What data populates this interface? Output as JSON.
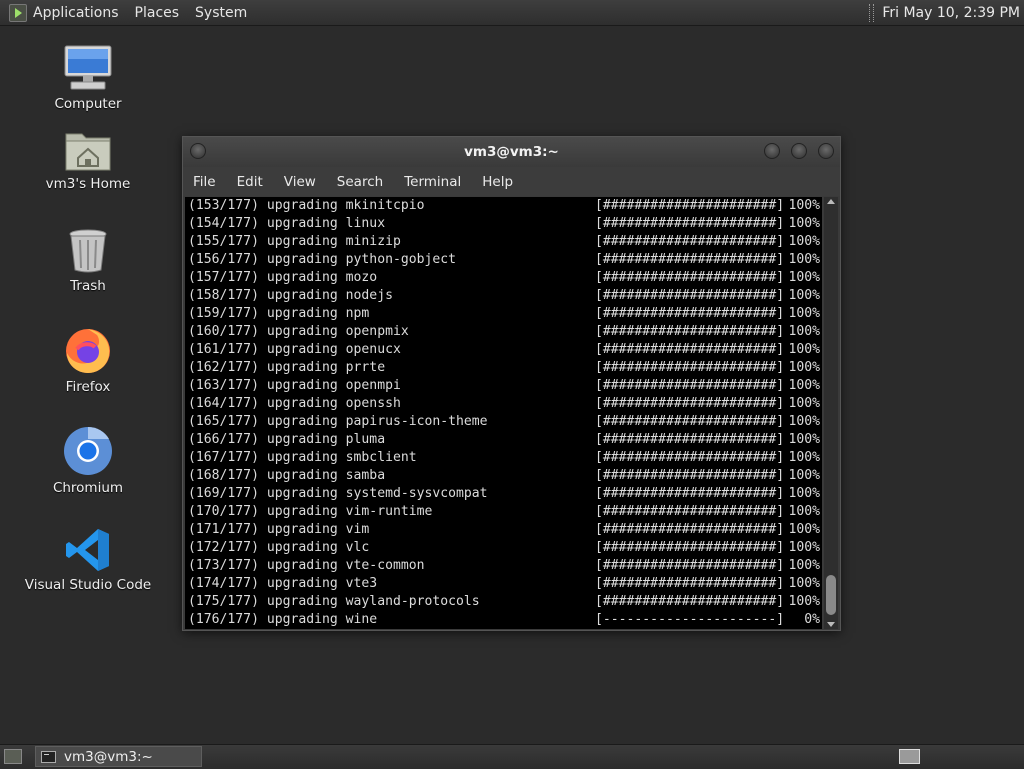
{
  "top_panel": {
    "menus": [
      "Applications",
      "Places",
      "System"
    ],
    "clock": "Fri May 10,  2:39 PM"
  },
  "desktop_icons": [
    {
      "label": "Computer",
      "icon": "computer-icon"
    },
    {
      "label": "vm3's Home",
      "icon": "home-folder-icon"
    },
    {
      "label": "Trash",
      "icon": "trash-icon"
    },
    {
      "label": "Firefox",
      "icon": "firefox-icon"
    },
    {
      "label": "Chromium",
      "icon": "chromium-icon"
    },
    {
      "label": "Visual Studio Code",
      "icon": "vscode-icon"
    }
  ],
  "terminal": {
    "title": "vm3@vm3:~",
    "menu": [
      "File",
      "Edit",
      "View",
      "Search",
      "Terminal",
      "Help"
    ],
    "lines": [
      {
        "text": "(153/177) upgrading mkinitcpio",
        "bar": "[######################]",
        "pct": "100%"
      },
      {
        "text": "(154/177) upgrading linux",
        "bar": "[######################]",
        "pct": "100%"
      },
      {
        "text": "(155/177) upgrading minizip",
        "bar": "[######################]",
        "pct": "100%"
      },
      {
        "text": "(156/177) upgrading python-gobject",
        "bar": "[######################]",
        "pct": "100%"
      },
      {
        "text": "(157/177) upgrading mozo",
        "bar": "[######################]",
        "pct": "100%"
      },
      {
        "text": "(158/177) upgrading nodejs",
        "bar": "[######################]",
        "pct": "100%"
      },
      {
        "text": "(159/177) upgrading npm",
        "bar": "[######################]",
        "pct": "100%"
      },
      {
        "text": "(160/177) upgrading openpmix",
        "bar": "[######################]",
        "pct": "100%"
      },
      {
        "text": "(161/177) upgrading openucx",
        "bar": "[######################]",
        "pct": "100%"
      },
      {
        "text": "(162/177) upgrading prrte",
        "bar": "[######################]",
        "pct": "100%"
      },
      {
        "text": "(163/177) upgrading openmpi",
        "bar": "[######################]",
        "pct": "100%"
      },
      {
        "text": "(164/177) upgrading openssh",
        "bar": "[######################]",
        "pct": "100%"
      },
      {
        "text": "(165/177) upgrading papirus-icon-theme",
        "bar": "[######################]",
        "pct": "100%"
      },
      {
        "text": "(166/177) upgrading pluma",
        "bar": "[######################]",
        "pct": "100%"
      },
      {
        "text": "(167/177) upgrading smbclient",
        "bar": "[######################]",
        "pct": "100%"
      },
      {
        "text": "(168/177) upgrading samba",
        "bar": "[######################]",
        "pct": "100%"
      },
      {
        "text": "(169/177) upgrading systemd-sysvcompat",
        "bar": "[######################]",
        "pct": "100%"
      },
      {
        "text": "(170/177) upgrading vim-runtime",
        "bar": "[######################]",
        "pct": "100%"
      },
      {
        "text": "(171/177) upgrading vim",
        "bar": "[######################]",
        "pct": "100%"
      },
      {
        "text": "(172/177) upgrading vlc",
        "bar": "[######################]",
        "pct": "100%"
      },
      {
        "text": "(173/177) upgrading vte-common",
        "bar": "[######################]",
        "pct": "100%"
      },
      {
        "text": "(174/177) upgrading vte3",
        "bar": "[######################]",
        "pct": "100%"
      },
      {
        "text": "(175/177) upgrading wayland-protocols",
        "bar": "[######################]",
        "pct": "100%"
      },
      {
        "text": "(176/177) upgrading wine",
        "bar": "[----------------------]",
        "pct": "0%"
      }
    ]
  },
  "taskbar": {
    "window_button": "vm3@vm3:~"
  }
}
